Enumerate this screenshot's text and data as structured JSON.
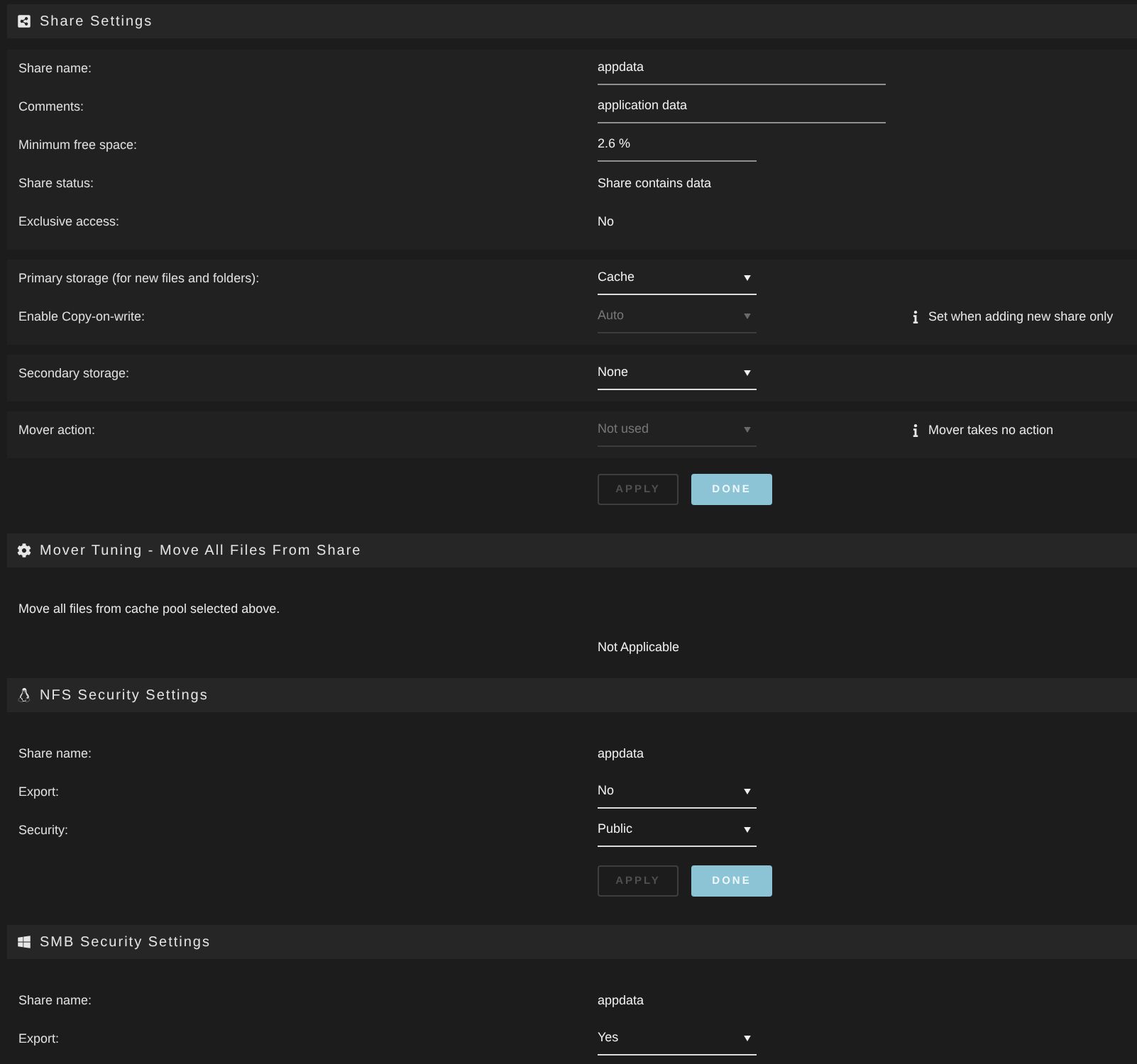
{
  "sections": [
    {
      "kind": "share",
      "title": "Share Settings",
      "groups": [
        {
          "rows": [
            {
              "kind": "input",
              "label": "Share name:",
              "value": "appdata",
              "disabled": false
            },
            {
              "kind": "input",
              "label": "Comments:",
              "value": "application data",
              "disabled": false
            },
            {
              "kind": "number",
              "label": "Minimum free space:",
              "value": "2.6 %",
              "disabled": false
            },
            {
              "kind": "text",
              "label": "Share status:",
              "value": "Share contains data"
            },
            {
              "kind": "text",
              "label": "Exclusive access:",
              "value": "No"
            }
          ]
        },
        {
          "rows": [
            {
              "kind": "select",
              "label": "Primary storage (for new files and folders):",
              "value": "Cache",
              "disabled": false
            },
            {
              "kind": "select",
              "label": "Enable Copy-on-write:",
              "value": "Auto",
              "disabled": true,
              "note": "Set when adding new share only"
            }
          ]
        },
        {
          "rows": [
            {
              "kind": "select",
              "label": "Secondary storage:",
              "value": "None",
              "disabled": false
            }
          ]
        },
        {
          "rows": [
            {
              "kind": "select",
              "label": "Mover action:",
              "value": "Not used",
              "disabled": true,
              "note": "Mover takes no action"
            }
          ]
        }
      ],
      "buttons": [
        {
          "label": "APPLY",
          "disabled": true
        },
        {
          "label": "DONE",
          "disabled": false
        }
      ]
    },
    {
      "kind": "mover",
      "title": "Mover Tuning - Move All Files From Share",
      "rows": [
        {
          "kind": "description",
          "label": "Move all files from cache pool selected above."
        },
        {
          "kind": "text",
          "value": "Not Applicable"
        }
      ]
    },
    {
      "kind": "nfs",
      "title": "NFS Security Settings",
      "rows": [
        {
          "kind": "text",
          "label": "Share name:",
          "value": "appdata"
        },
        {
          "kind": "select",
          "label": "Export:",
          "value": "No",
          "disabled": false
        },
        {
          "kind": "select",
          "label": "Security:",
          "value": "Public",
          "disabled": false
        }
      ],
      "buttons": [
        {
          "label": "APPLY",
          "disabled": true
        },
        {
          "label": "DONE",
          "disabled": false
        }
      ]
    },
    {
      "kind": "smb",
      "title": "SMB Security Settings",
      "rows": [
        {
          "kind": "text",
          "label": "Share name:",
          "value": "appdata"
        },
        {
          "kind": "select",
          "label": "Export:",
          "value": "Yes",
          "disabled": false
        }
      ]
    }
  ]
}
